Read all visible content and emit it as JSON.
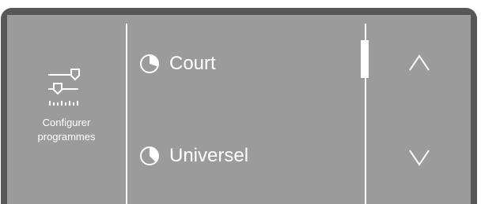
{
  "config": {
    "label_line1": "Configurer",
    "label_line2": "programmes",
    "icon": "sliders-icon"
  },
  "programs": [
    {
      "label": "Court",
      "icon": "timer-quarter-icon"
    },
    {
      "label": "Universel",
      "icon": "timer-half-icon"
    }
  ],
  "nav": {
    "up_icon": "chevron-up-icon",
    "down_icon": "chevron-down-icon"
  },
  "colors": {
    "screen": "#9b9b9b",
    "frame": "#575757",
    "foreground": "#ffffff"
  }
}
